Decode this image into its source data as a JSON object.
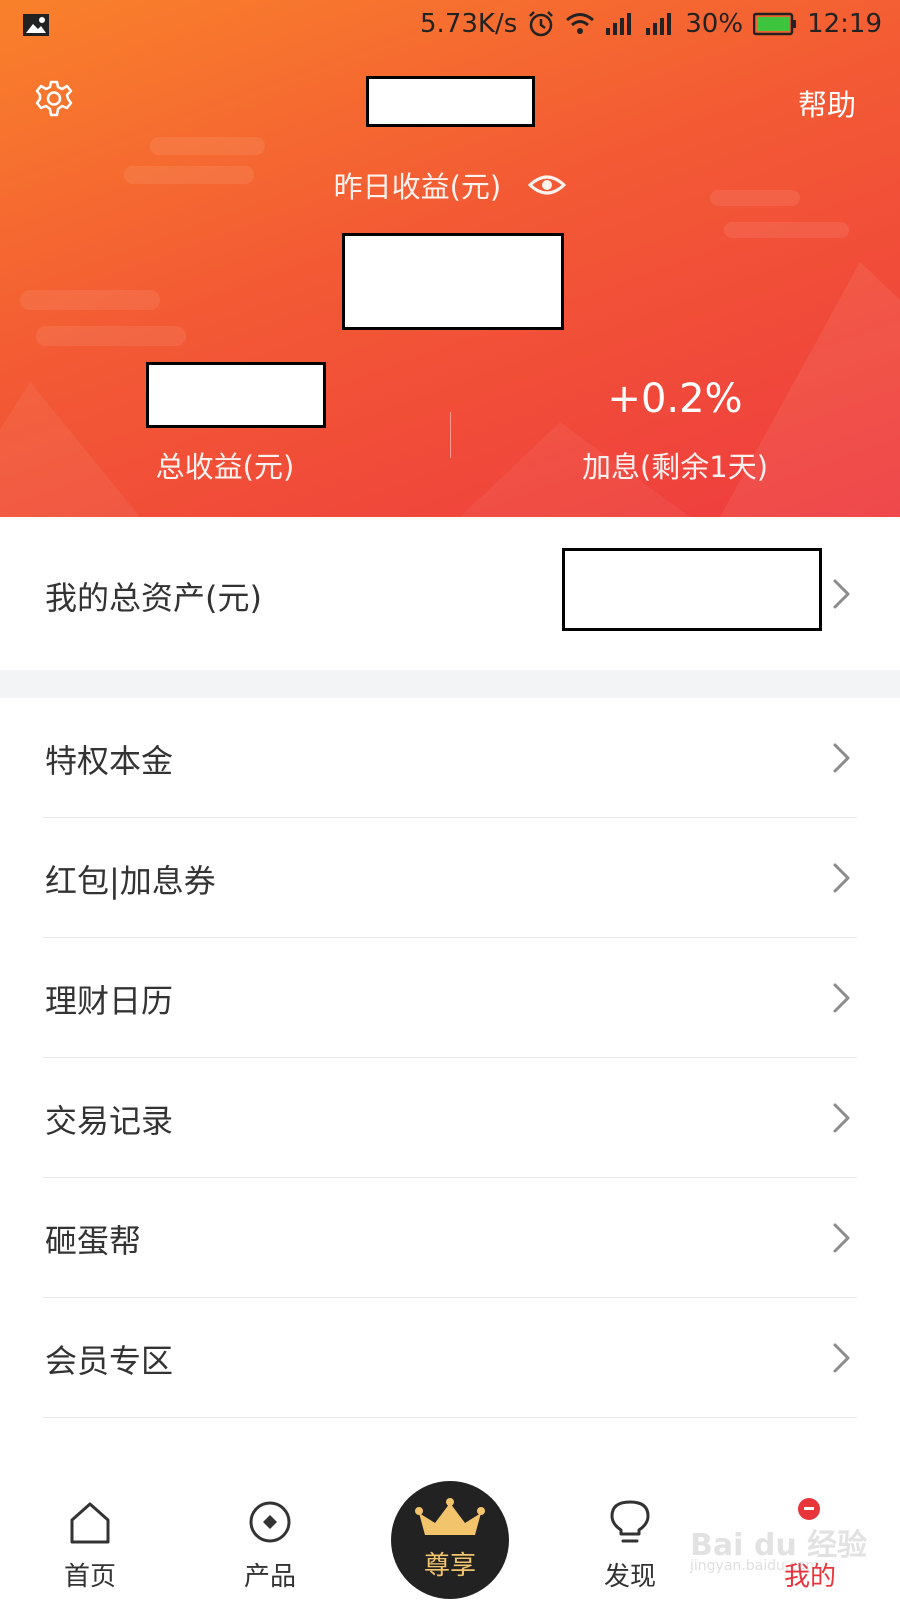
{
  "status_bar": {
    "net_speed": "5.73K/s",
    "battery": "30%",
    "time": "12:19"
  },
  "header": {
    "help_label": "帮助",
    "yesterday_label": "昨日收益(元)",
    "bonus_rate": "+0.2%",
    "total_income_label": "总收益(元)",
    "bonus_label": "加息(剩余1天)"
  },
  "assets": {
    "label": "我的总资产(元)"
  },
  "menu": {
    "items": [
      {
        "label": "特权本金"
      },
      {
        "label": "红包|加息券"
      },
      {
        "label": "理财日历"
      },
      {
        "label": "交易记录"
      },
      {
        "label": "砸蛋帮"
      },
      {
        "label": "会员专区"
      }
    ]
  },
  "tabbar": {
    "home": "首页",
    "products": "产品",
    "vip": "尊享",
    "discover": "发现",
    "mine": "我的"
  },
  "colors": {
    "header_start": "#f9812b",
    "header_end": "#ee3b3f",
    "vip_gold": "#f2c46b",
    "badge_red": "#e8343b"
  },
  "watermark": {
    "text": "Bai du 经验",
    "sub": "jingyan.baidu.com"
  }
}
